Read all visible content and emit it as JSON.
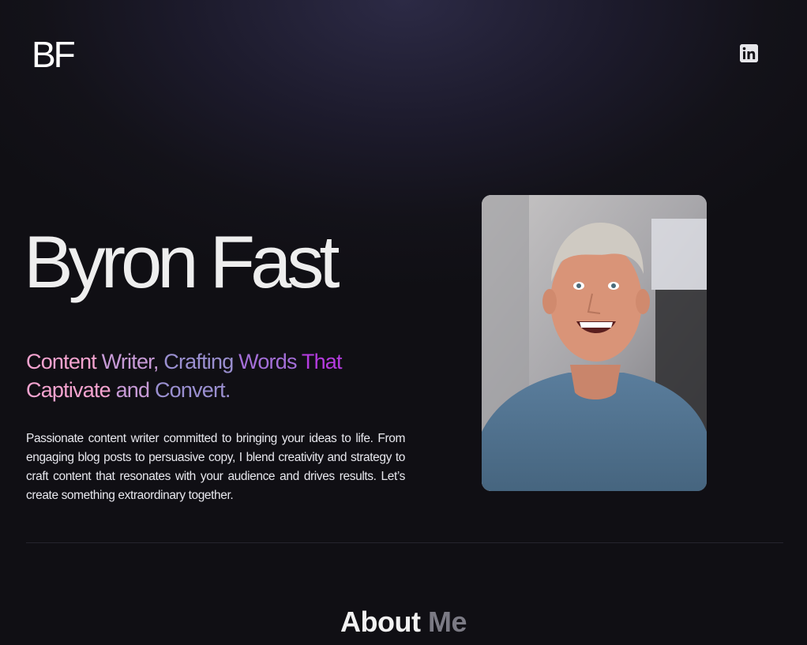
{
  "header": {
    "logo": "BF",
    "linkedin_icon": "linkedin-icon"
  },
  "hero": {
    "name": "Byron Fast",
    "tagline_words": [
      {
        "text": "Content",
        "color": "#f4a3cf"
      },
      {
        "text": "Writer,",
        "color": "#c79ad6"
      },
      {
        "text": "Crafting",
        "color": "#9a8fd0"
      },
      {
        "text": "Words",
        "color": "#a46fd8"
      },
      {
        "text": "That",
        "color": "#b53ce0"
      },
      {
        "text": "Captivate",
        "color": "#f4a3cf"
      },
      {
        "text": "and",
        "color": "#c79ad6"
      },
      {
        "text": "Convert.",
        "color": "#9a8fd0"
      }
    ],
    "intro": "Passionate content writer committed to bringing your ideas to life. From engaging blog posts to persuasive copy, I blend creativity and strategy to craft content that resonates with your audience and drives results. Let’s create something extraordinary together.",
    "portrait_alt": "Byron Fast smiling portrait"
  },
  "about": {
    "title_part1": "About",
    "title_part2": "Me"
  }
}
